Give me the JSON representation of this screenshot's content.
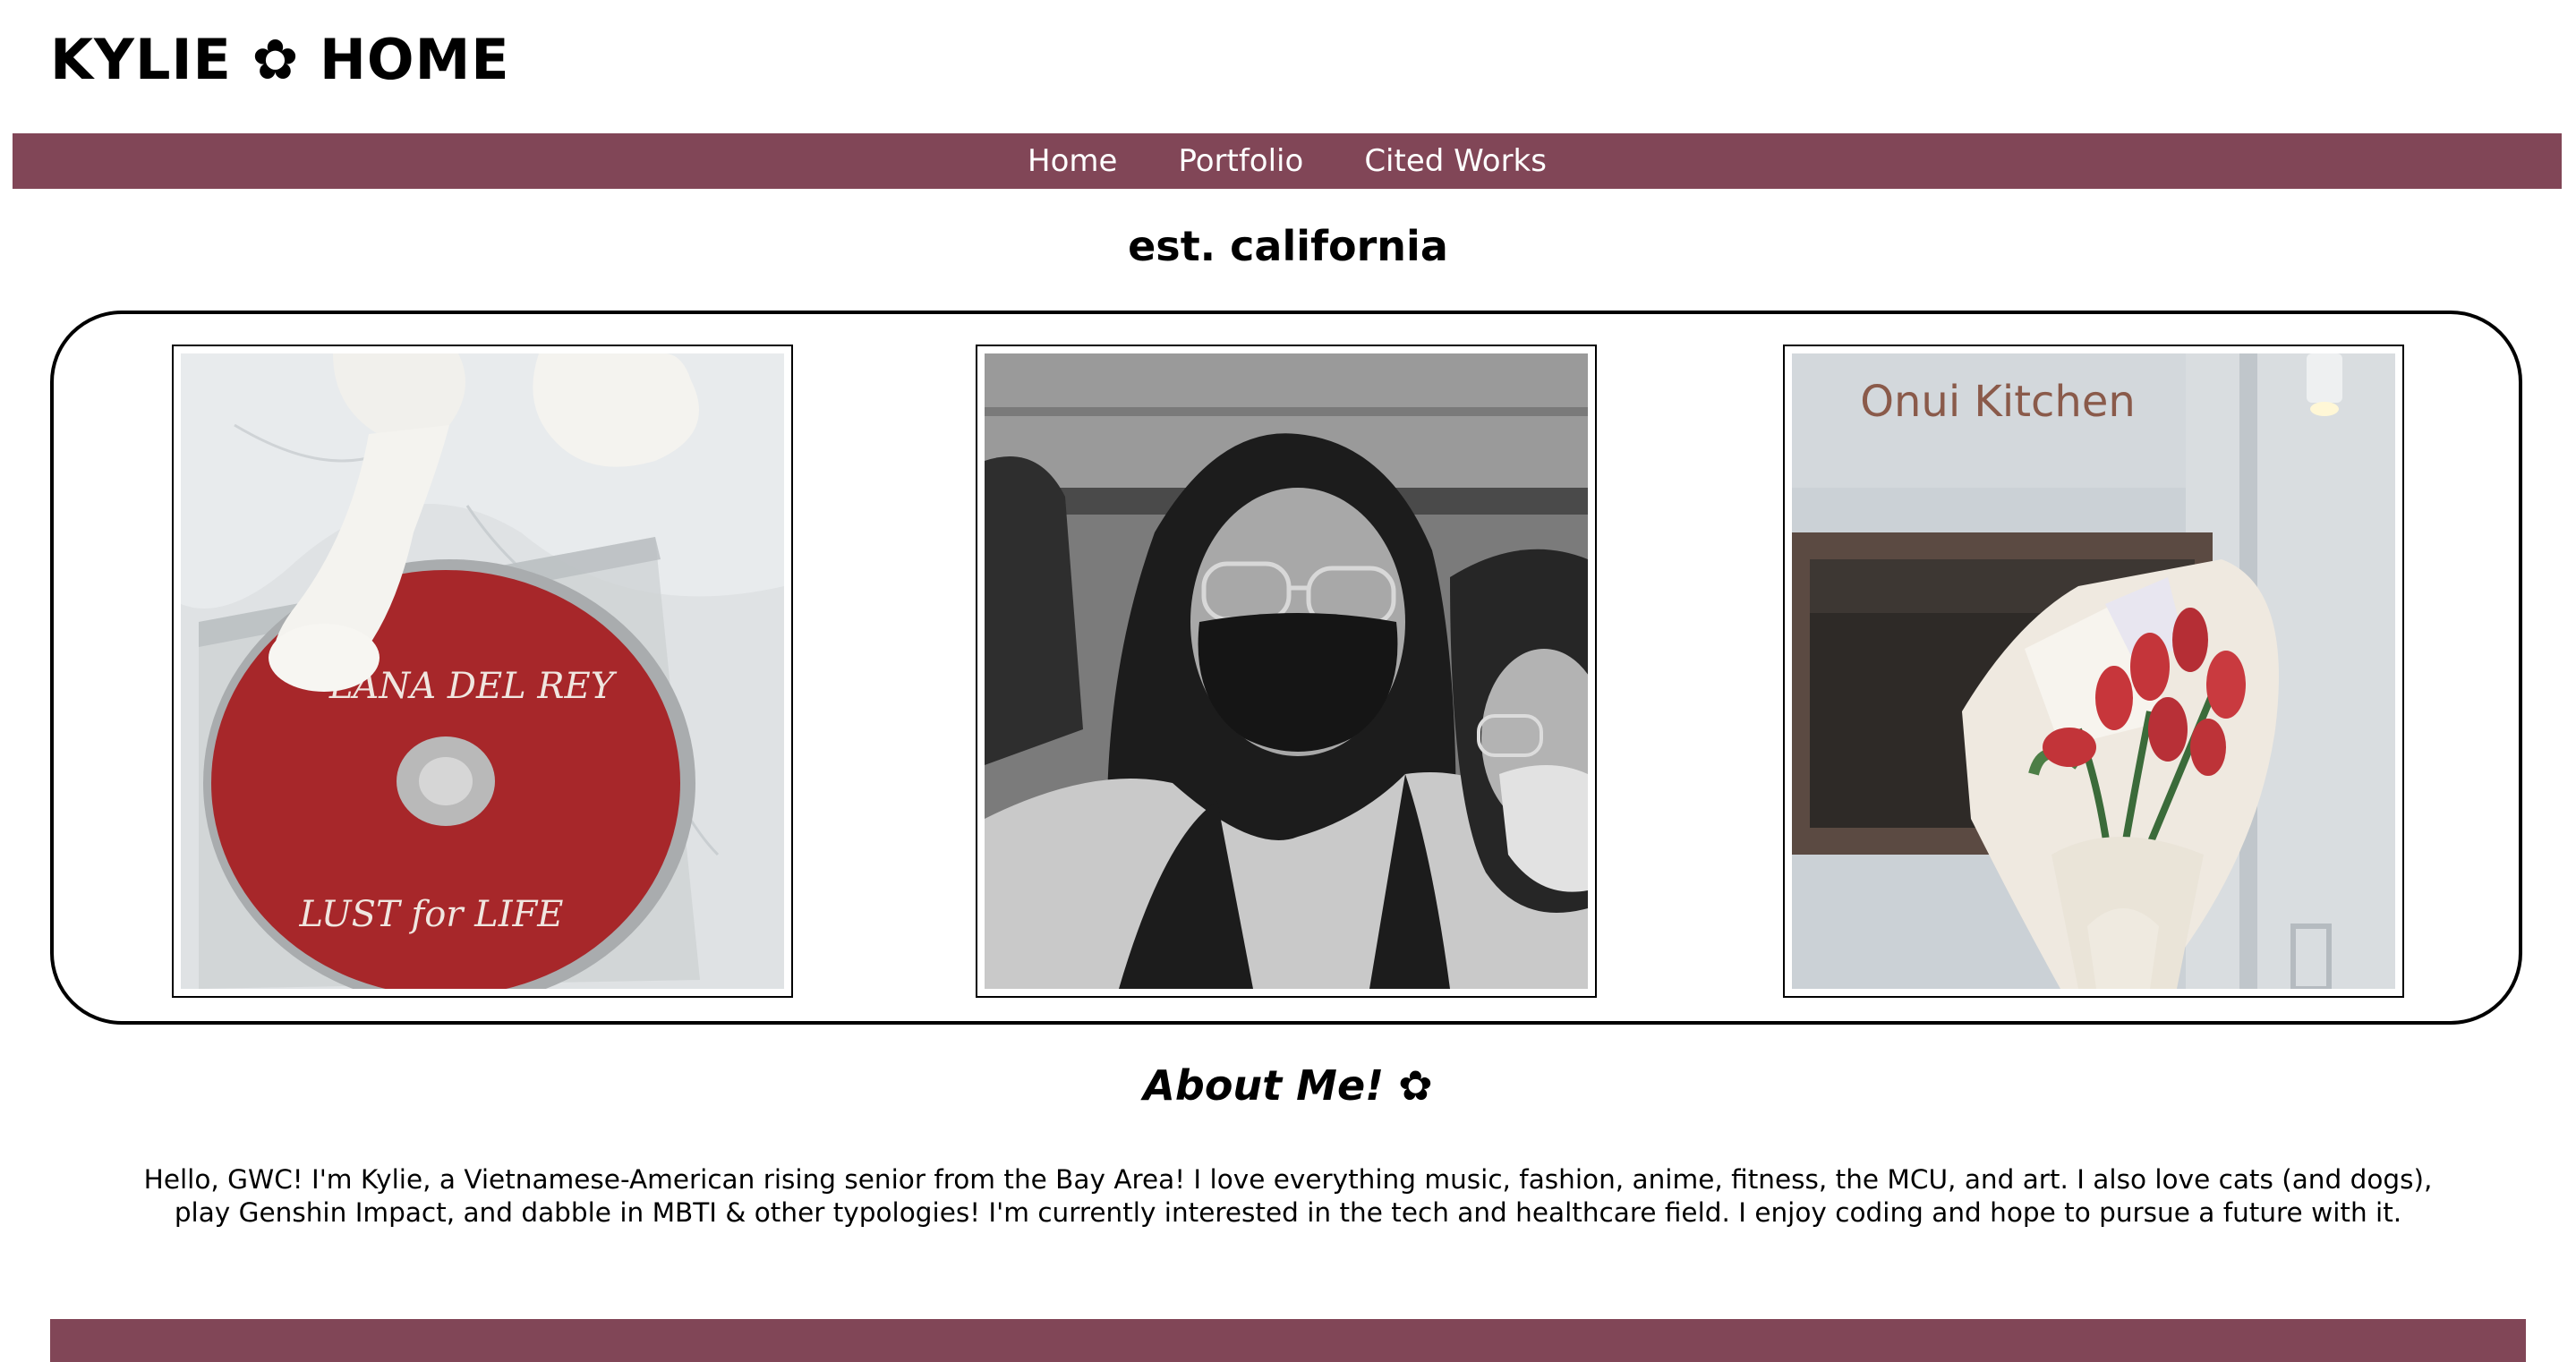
{
  "header": {
    "site_title": "KYLIE ✿ HOME"
  },
  "nav": {
    "items": [
      {
        "label": "Home"
      },
      {
        "label": "Portfolio"
      },
      {
        "label": "Cited Works"
      }
    ]
  },
  "hero": {
    "tagline": "est. california"
  },
  "gallery": {
    "photos": [
      {
        "subject": "cat paws on a red Lana Del Rey Lust for Life CD",
        "disc_text_1": "LANA DEL REY",
        "disc_text_2": "LUST for LIFE"
      },
      {
        "subject": "black and white selfie of two friends"
      },
      {
        "subject": "bouquet of red tulips in front of a restaurant",
        "sign_text": "Onui Kitchen"
      }
    ]
  },
  "about": {
    "heading": "About Me! ✿",
    "body": "Hello, GWC! I'm Kylie, a Vietnamese-American rising senior from the Bay Area! I love everything music, fashion, anime, fitness, the MCU, and art. I also love cats (and dogs), play Genshin Impact, and dabble in MBTI & other typologies! I'm currently interested in the tech and healthcare field. I enjoy coding and hope to pursue a future with it."
  },
  "colors": {
    "accent": "#814657",
    "background": "#ffffff",
    "text": "#000000"
  }
}
